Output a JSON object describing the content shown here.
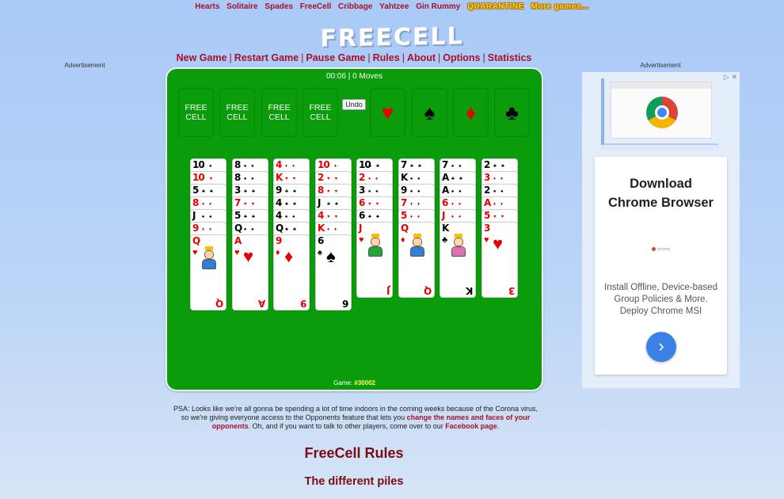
{
  "top_nav": {
    "links": [
      "Hearts",
      "Solitaire",
      "Spades",
      "FreeCell",
      "Cribbage",
      "Yahtzee",
      "Gin Rummy"
    ],
    "special_links": [
      "QUARANTINE",
      "More games..."
    ]
  },
  "logo": "FREECELL",
  "menu": [
    "New Game",
    "Restart Game",
    "Pause Game",
    "Rules",
    "About",
    "Options",
    "Statistics"
  ],
  "ads": {
    "left_label": "Advertisement",
    "right_label": "Advertisement",
    "adchoices": "▷ ✕",
    "title_line1": "Download",
    "title_line2": "Chrome Browser",
    "brand": "chrome",
    "description": "Install Offline, Device-based Group Policies & More. Deploy Chrome MSI",
    "cta_icon": "›"
  },
  "game": {
    "timer": "00:06",
    "moves": "0 Moves",
    "status": "00:06 | 0 Moves",
    "free_cells": [
      {
        "line1": "FREE",
        "line2": "CELL"
      },
      {
        "line1": "FREE",
        "line2": "CELL"
      },
      {
        "line1": "FREE",
        "line2": "CELL"
      },
      {
        "line1": "FREE",
        "line2": "CELL"
      }
    ],
    "undo_label": "Undo",
    "foundations": [
      {
        "suit": "hearts",
        "symbol": "♥",
        "color": "red"
      },
      {
        "suit": "spades",
        "symbol": "♠",
        "color": "black"
      },
      {
        "suit": "diamonds",
        "symbol": "♦",
        "color": "red"
      },
      {
        "suit": "clubs",
        "symbol": "♣",
        "color": "black"
      }
    ],
    "columns": [
      [
        {
          "rank": "10",
          "suit": "♠",
          "color": "black"
        },
        {
          "rank": "10",
          "suit": "♥",
          "color": "red"
        },
        {
          "rank": "5",
          "suit": "♣",
          "color": "black"
        },
        {
          "rank": "8",
          "suit": "♦",
          "color": "red"
        },
        {
          "rank": "J",
          "suit": "♠",
          "color": "black"
        },
        {
          "rank": "9",
          "suit": "♦",
          "color": "red"
        },
        {
          "rank": "Q",
          "suit": "♥",
          "color": "red"
        }
      ],
      [
        {
          "rank": "8",
          "suit": "♠",
          "color": "black"
        },
        {
          "rank": "8",
          "suit": "♠",
          "color": "black"
        },
        {
          "rank": "3",
          "suit": "♣",
          "color": "black"
        },
        {
          "rank": "7",
          "suit": "♥",
          "color": "red"
        },
        {
          "rank": "5",
          "suit": "♣",
          "color": "black"
        },
        {
          "rank": "Q",
          "suit": "♠",
          "color": "black"
        },
        {
          "rank": "A",
          "suit": "♥",
          "color": "red"
        }
      ],
      [
        {
          "rank": "4",
          "suit": "♦",
          "color": "red"
        },
        {
          "rank": "K",
          "suit": "♥",
          "color": "red"
        },
        {
          "rank": "9",
          "suit": "♣",
          "color": "black"
        },
        {
          "rank": "4",
          "suit": "♣",
          "color": "black"
        },
        {
          "rank": "4",
          "suit": "♠",
          "color": "black"
        },
        {
          "rank": "Q",
          "suit": "♣",
          "color": "black"
        },
        {
          "rank": "9",
          "suit": "♦",
          "color": "red"
        }
      ],
      [
        {
          "rank": "10",
          "suit": "♦",
          "color": "red"
        },
        {
          "rank": "2",
          "suit": "♥",
          "color": "red"
        },
        {
          "rank": "8",
          "suit": "♥",
          "color": "red"
        },
        {
          "rank": "J",
          "suit": "♣",
          "color": "black"
        },
        {
          "rank": "4",
          "suit": "♥",
          "color": "red"
        },
        {
          "rank": "K",
          "suit": "♦",
          "color": "red"
        },
        {
          "rank": "6",
          "suit": "♠",
          "color": "black"
        }
      ],
      [
        {
          "rank": "10",
          "suit": "♣",
          "color": "black"
        },
        {
          "rank": "2",
          "suit": "♦",
          "color": "red"
        },
        {
          "rank": "3",
          "suit": "♠",
          "color": "black"
        },
        {
          "rank": "6",
          "suit": "♥",
          "color": "red"
        },
        {
          "rank": "6",
          "suit": "♣",
          "color": "black"
        },
        {
          "rank": "J",
          "suit": "♥",
          "color": "red"
        }
      ],
      [
        {
          "rank": "7",
          "suit": "♣",
          "color": "black"
        },
        {
          "rank": "K",
          "suit": "♠",
          "color": "black"
        },
        {
          "rank": "9",
          "suit": "♠",
          "color": "black"
        },
        {
          "rank": "7",
          "suit": "♦",
          "color": "red"
        },
        {
          "rank": "5",
          "suit": "♦",
          "color": "red"
        },
        {
          "rank": "Q",
          "suit": "♦",
          "color": "red"
        }
      ],
      [
        {
          "rank": "7",
          "suit": "♠",
          "color": "black"
        },
        {
          "rank": "A",
          "suit": "♣",
          "color": "black"
        },
        {
          "rank": "A",
          "suit": "♠",
          "color": "black"
        },
        {
          "rank": "6",
          "suit": "♦",
          "color": "red"
        },
        {
          "rank": "J",
          "suit": "♦",
          "color": "red"
        },
        {
          "rank": "K",
          "suit": "♣",
          "color": "black"
        }
      ],
      [
        {
          "rank": "2",
          "suit": "♣",
          "color": "black"
        },
        {
          "rank": "3",
          "suit": "♦",
          "color": "red"
        },
        {
          "rank": "2",
          "suit": "♠",
          "color": "black"
        },
        {
          "rank": "A",
          "suit": "♦",
          "color": "red"
        },
        {
          "rank": "5",
          "suit": "♥",
          "color": "red"
        },
        {
          "rank": "3",
          "suit": "♥",
          "color": "red"
        }
      ]
    ],
    "game_label": "Game:",
    "game_number": "#30002"
  },
  "psa": {
    "text1": "PSA: Looks like we're all gonna be spending a lot of time indoors in the coming weeks because of the Corona virus, so we're giving everyone access to the Opponents feature that lets you ",
    "link1": "change the names and faces of your opponents",
    "text2": ". Oh, and if you want to talk to other players, come over to our ",
    "link2": "Facebook page",
    "text3": "."
  },
  "rules": {
    "heading": "FreeCell Rules",
    "subheading": "The different piles"
  },
  "colors": {
    "board_green": "#0a9c0a",
    "link_red": "#a8102a",
    "heading_maroon": "#7a0c14",
    "card_red": "#e60000",
    "game_number_yellow": "#ffff66"
  }
}
